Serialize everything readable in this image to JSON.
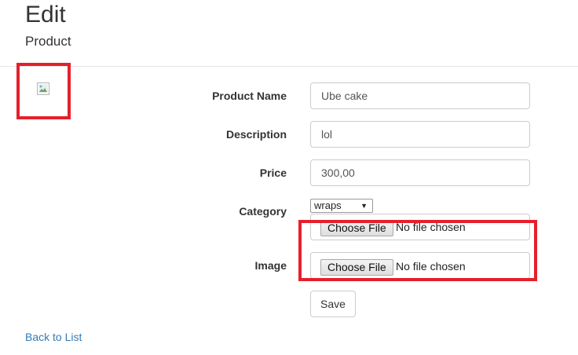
{
  "header": {
    "title": "Edit",
    "subtitle": "Product"
  },
  "form": {
    "product_name": {
      "label": "Product Name",
      "value": "Ube cake"
    },
    "description": {
      "label": "Description",
      "value": "lol"
    },
    "price": {
      "label": "Price",
      "value": "300,00"
    },
    "category": {
      "label": "Category",
      "selected": "wraps"
    },
    "image": {
      "label": "Image",
      "choose_label": "Choose File",
      "status": "No file chosen"
    },
    "extra_file": {
      "choose_label": "Choose File",
      "status": "No file chosen"
    },
    "save_label": "Save"
  },
  "footer": {
    "back_link": "Back to List"
  },
  "annotation_color": "#e5202b"
}
